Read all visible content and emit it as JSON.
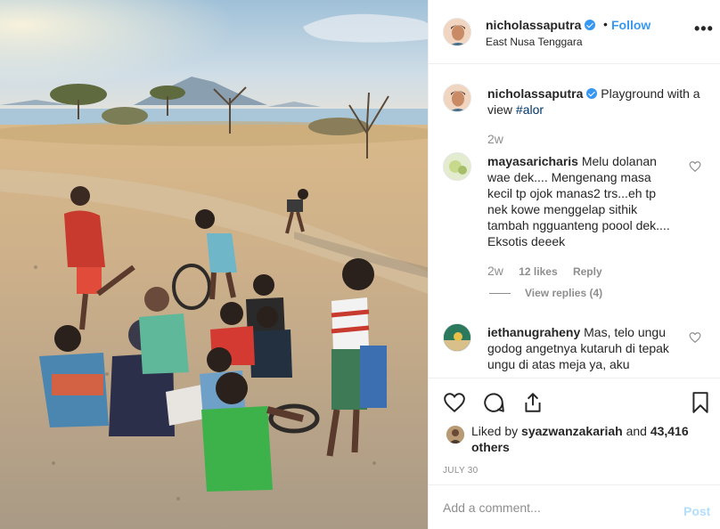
{
  "post": {
    "photo_alt": "Children playing on a sandy beach with a volcano in the distance",
    "header": {
      "username": "nicholassaputra",
      "separator": "•",
      "follow_label": "Follow",
      "location": "East Nusa Tenggara",
      "more_label": "•••"
    },
    "caption": {
      "username": "nicholassaputra",
      "text": "Playground with a view",
      "hashtag": "#alor",
      "time": "2w"
    },
    "comments": [
      {
        "username": "mayasaricharis",
        "text": "Melu dolanan wae dek.... Mengenang masa kecil tp ojok manas2 trs...eh tp nek kowe menggelap sithik tambah ngguanteng poool dek.... Eksotis deeek",
        "time": "2w",
        "likes": "12 likes",
        "reply_label": "Reply",
        "view_replies": "View replies (4)"
      },
      {
        "username": "iethanugraheny",
        "text": "Mas, telo ungu godog angetnya kutaruh di tepak ungu di atas meja ya, aku"
      }
    ],
    "likes": {
      "prefix": "Liked by",
      "user": "syazwanzakariah",
      "and": "and",
      "others": "43,416 others"
    },
    "date": "JULY 30",
    "add_comment": {
      "placeholder": "Add a comment...",
      "post_label": "Post"
    }
  },
  "colors": {
    "link_blue": "#3897f0",
    "hashtag": "#003569",
    "muted": "#8e8e8e",
    "post_disabled": "#b2dffc"
  },
  "icons": [
    "verified-badge-icon",
    "heart-icon",
    "comment-icon",
    "share-icon",
    "bookmark-icon",
    "more-options-icon"
  ]
}
